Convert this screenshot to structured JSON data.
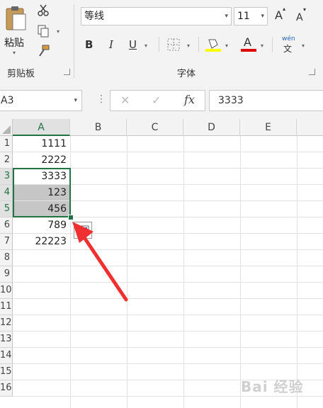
{
  "ribbon": {
    "clipboard": {
      "paste_label": "粘贴",
      "group_label": "剪贴板"
    },
    "font": {
      "font_name": "等线",
      "font_size": "11",
      "grow_label": "A",
      "shrink_label": "A",
      "bold_label": "B",
      "italic_label": "I",
      "underline_label": "U",
      "font_color_label": "A",
      "phonetic_top": "wén",
      "phonetic_bottom": "文",
      "group_label": "字体",
      "highlight_color": "#ffff00",
      "font_color": "#e00000"
    }
  },
  "formula_bar": {
    "name_box": "A3",
    "fx_label": "fx",
    "cancel_label": "✕",
    "enter_label": "✓",
    "formula": "3333"
  },
  "sheet": {
    "columns": [
      "A",
      "B",
      "C",
      "D",
      "E"
    ],
    "rows": [
      "1",
      "2",
      "3",
      "4",
      "5",
      "6",
      "7",
      "8",
      "9",
      "10",
      "11",
      "12",
      "13",
      "14",
      "15",
      "16"
    ],
    "cells_A": [
      "1111",
      "2222",
      "3333",
      "123",
      "456",
      "789",
      "22223"
    ],
    "selected_range": "A3:A5"
  },
  "annotation": {
    "arrow_color": "#f03030"
  },
  "watermark": "Bai 经验"
}
